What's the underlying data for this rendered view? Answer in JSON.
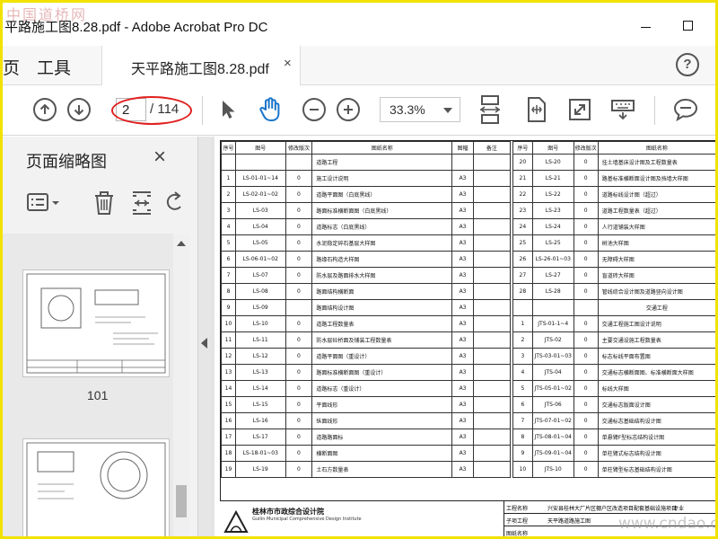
{
  "window": {
    "watermark_top": "中国道桥网",
    "title": "平路施工图8.28.pdf - Adobe Acrobat Pro DC"
  },
  "tabs": {
    "home_fragment": "页",
    "tools": "工具",
    "document": "天平路施工图8.28.pdf",
    "close": "×",
    "help": "?"
  },
  "toolbar": {
    "current_page": "2",
    "total_pages": "/ 114",
    "zoom": "33.3%",
    "annotation_color": "#e02020"
  },
  "left_panel": {
    "title": "页面缩略图",
    "close": "×",
    "thumbnail_labels": [
      "101"
    ]
  },
  "drawing": {
    "headers": [
      "序号",
      "图号",
      "修改版次",
      "图纸名称",
      "图幅",
      "备注",
      "序号",
      "图号",
      "修改版次",
      "图纸名称"
    ],
    "section_road": "道路工程",
    "section_traffic": "交通工程",
    "left_rows": [
      [
        "1",
        "LS-01-01~14",
        "0",
        "施工设计说明",
        "A3"
      ],
      [
        "2",
        "LS-02-01~02",
        "0",
        "道路平面图（白底黑线）",
        "A3"
      ],
      [
        "3",
        "LS-03",
        "0",
        "路面标准横断面图（白底黑线）",
        "A3"
      ],
      [
        "4",
        "LS-04",
        "0",
        "道路标志（白底黑线）",
        "A3"
      ],
      [
        "5",
        "LS-05",
        "0",
        "水泥稳定碎石基层大样图",
        "A3"
      ],
      [
        "6",
        "LS-06-01~02",
        "0",
        "路缘石构造大样图",
        "A3"
      ],
      [
        "7",
        "LS-07",
        "0",
        "防水层及路面排水大样图",
        "A3"
      ],
      [
        "8",
        "LS-08",
        "0",
        "路面结构横断面",
        "A3"
      ],
      [
        "9",
        "LS-09",
        "",
        "路面结构设计图",
        "A3"
      ],
      [
        "10",
        "LS-10",
        "0",
        "道路工程数量表",
        "A3"
      ],
      [
        "11",
        "LS-11",
        "0",
        "防水层砼桥面及铺装工程数量表",
        "A3"
      ],
      [
        "12",
        "LS-12",
        "0",
        "道路平面图（重设计）",
        "A3"
      ],
      [
        "13",
        "LS-13",
        "0",
        "路面标准横断面图（重设计）",
        "A3"
      ],
      [
        "14",
        "LS-14",
        "0",
        "道路标志（重设计）",
        "A3"
      ],
      [
        "15",
        "LS-15",
        "0",
        "平面线形",
        "A3"
      ],
      [
        "16",
        "LS-16",
        "0",
        "纵面线形",
        "A3"
      ],
      [
        "17",
        "LS-17",
        "0",
        "道路路面标",
        "A3"
      ],
      [
        "18",
        "LS-18-01~03",
        "0",
        "横断面图",
        "A3"
      ],
      [
        "19",
        "LS-19",
        "0",
        "土石方数量表",
        "A3"
      ]
    ],
    "right_rows": [
      [
        "20",
        "LS-20",
        "0",
        "挂土墙基床设计图及工程数量表"
      ],
      [
        "21",
        "LS-21",
        "0",
        "路基标准横断面设计图及挡墙大样图"
      ],
      [
        "22",
        "LS-22",
        "0",
        "道路标线设计图（超过）"
      ],
      [
        "23",
        "LS-23",
        "0",
        "道路工程数量表（超过）"
      ],
      [
        "24",
        "LS-24",
        "0",
        "人行道铺装大样图"
      ],
      [
        "25",
        "LS-25",
        "0",
        "树池大样图"
      ],
      [
        "26",
        "LS-26-01~03",
        "0",
        "无障碍大样图"
      ],
      [
        "27",
        "LS-27",
        "0",
        "盲道砖大样图"
      ],
      [
        "28",
        "LS-28",
        "0",
        "管线综合设计图及道路竖向设计图"
      ],
      [
        "",
        "",
        "",
        ""
      ],
      [
        "1",
        "JTS-01-1~4",
        "0",
        "交通工程施工图设计说明"
      ],
      [
        "2",
        "JTS-02",
        "0",
        "主要交通设施工程数量表"
      ],
      [
        "3",
        "JTS-03-01~03",
        "0",
        "标志标线平面布置图"
      ],
      [
        "4",
        "JTS-04",
        "0",
        "交通标志横断面图、标准横断面大样图"
      ],
      [
        "5",
        "JTS-05-01~02",
        "0",
        "标线大样图"
      ],
      [
        "6",
        "JTS-06",
        "0",
        "交通标志版面设计图"
      ],
      [
        "7",
        "JTS-07-01~02",
        "0",
        "交通标志基础结构设计图"
      ],
      [
        "8",
        "JTS-08-01~04",
        "0",
        "单悬臂F型标志结构设计图"
      ],
      [
        "9",
        "JTS-09-01~04",
        "0",
        "单柱臂式标志结构设计图"
      ],
      [
        "10",
        "JTS-10",
        "0",
        "单柱臂型标志基础结构设计图"
      ]
    ],
    "company_cn": "桂林市市政综合设计院",
    "company_en": "Guilin Municipal Comprehensive Design Institute",
    "project_label": "工程名称",
    "project_value": "兴安县桂林大厂片区棚户区改造项目配套基础设施项目",
    "subitem_label": "子项工程",
    "subitem_value": "天平路道路施工图",
    "drawing_label": "图纸名称",
    "spec_label": "专业",
    "site_watermark": "www.cndao.com"
  }
}
